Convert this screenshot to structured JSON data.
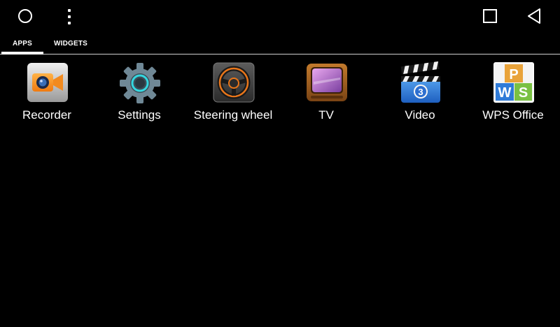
{
  "system_bar": {
    "home_icon": "circle-icon",
    "menu_icon": "overflow-menu-icon",
    "recents_icon": "square-icon",
    "back_icon": "triangle-back-icon"
  },
  "tabs": [
    {
      "label": "APPS",
      "selected": true
    },
    {
      "label": "WIDGETS",
      "selected": false
    }
  ],
  "apps": [
    {
      "label": "Recorder",
      "icon": "recorder-icon"
    },
    {
      "label": "Settings",
      "icon": "settings-gear-icon"
    },
    {
      "label": "Steering wheel",
      "icon": "steering-wheel-icon"
    },
    {
      "label": "TV",
      "icon": "tv-icon"
    },
    {
      "label": "Video",
      "icon": "video-clapper-icon"
    },
    {
      "label": "WPS Office",
      "icon": "wps-office-icon"
    }
  ],
  "colors": {
    "background": "#000000",
    "text": "#ffffff",
    "divider": "#cfcfcf"
  }
}
